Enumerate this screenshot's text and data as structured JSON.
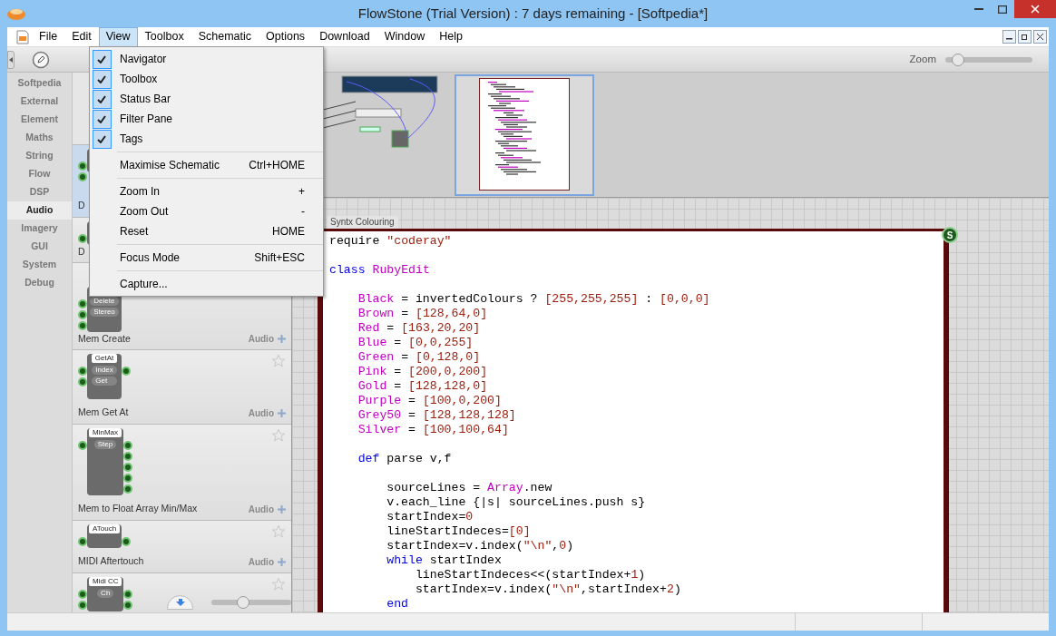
{
  "window": {
    "title": "FlowStone (Trial Version) : 7 days remaining - [Softpedia*]"
  },
  "menubar": [
    {
      "label": "File",
      "selected": false
    },
    {
      "label": "Edit",
      "selected": false
    },
    {
      "label": "View",
      "selected": true
    },
    {
      "label": "Toolbox",
      "selected": false
    },
    {
      "label": "Schematic",
      "selected": false
    },
    {
      "label": "Options",
      "selected": false
    },
    {
      "label": "Download",
      "selected": false
    },
    {
      "label": "Window",
      "selected": false
    },
    {
      "label": "Help",
      "selected": false
    }
  ],
  "view_menu": [
    {
      "kind": "check",
      "label": "Navigator",
      "checked": true
    },
    {
      "kind": "check",
      "label": "Toolbox",
      "checked": true
    },
    {
      "kind": "check",
      "label": "Status Bar",
      "checked": true
    },
    {
      "kind": "check",
      "label": "Filter Pane",
      "checked": true
    },
    {
      "kind": "check",
      "label": "Tags",
      "checked": true
    },
    {
      "kind": "separator"
    },
    {
      "kind": "item",
      "label": "Maximise Schematic",
      "shortcut": "Ctrl+HOME"
    },
    {
      "kind": "separator"
    },
    {
      "kind": "item",
      "label": "Zoom In",
      "shortcut": "+"
    },
    {
      "kind": "item",
      "label": "Zoom Out",
      "shortcut": "-"
    },
    {
      "kind": "item",
      "label": "Reset",
      "shortcut": "HOME"
    },
    {
      "kind": "separator"
    },
    {
      "kind": "item",
      "label": "Focus Mode",
      "shortcut": "Shift+ESC"
    },
    {
      "kind": "separator"
    },
    {
      "kind": "item",
      "label": "Capture..."
    }
  ],
  "categories": [
    {
      "label": "Softpedia",
      "selected": false
    },
    {
      "label": "External",
      "selected": false
    },
    {
      "label": "Element",
      "selected": false
    },
    {
      "label": "Maths",
      "selected": false
    },
    {
      "label": "String",
      "selected": false
    },
    {
      "label": "Flow",
      "selected": false
    },
    {
      "label": "DSP",
      "selected": false
    },
    {
      "label": "Audio",
      "selected": true
    },
    {
      "label": "Imagery",
      "selected": false
    },
    {
      "label": "GUI",
      "selected": false
    },
    {
      "label": "System",
      "selected": false
    },
    {
      "label": "Debug",
      "selected": false
    }
  ],
  "toolbox": {
    "components": [
      {
        "kind": "dual-pin",
        "title": "D",
        "selected": true
      },
      {
        "kind": "single-pin",
        "title": "D",
        "selected": false
      },
      {
        "kind": "mem-create",
        "title": "Mem Create",
        "tag": "Audio",
        "selected": false,
        "module": {
          "labels": [
            "Delete",
            "Stereo"
          ]
        }
      },
      {
        "kind": "get-at",
        "title": "Mem Get At",
        "tag": "Audio",
        "selected": false,
        "module": {
          "name": "GetAt",
          "labels": [
            "Index",
            "Get"
          ]
        }
      },
      {
        "kind": "min-max",
        "title": "Mem to Float Array Min/Max",
        "tag": "Audio",
        "selected": false,
        "module": {
          "name": "MinMax",
          "labels": [
            "Step"
          ]
        }
      },
      {
        "kind": "aftertouch",
        "title": "MIDI Aftertouch",
        "tag": "Audio",
        "selected": false,
        "module": {
          "name": "ATouch"
        }
      },
      {
        "kind": "midi-cc",
        "selected": false,
        "module": {
          "name": "Midi CC",
          "labels": [
            "Ch"
          ]
        }
      }
    ],
    "size_slider": {
      "level": 0.4
    }
  },
  "zoom": {
    "label": "Zoom",
    "level": 0.15
  },
  "module": {
    "tab": "Syntx Colouring",
    "badge": "S",
    "code": [
      {
        "tokens": [
          {
            "kind": "plain",
            "t": "require "
          },
          {
            "kind": "lit",
            "t": "\"coderay\""
          }
        ]
      },
      {
        "space_before": true,
        "tokens": [
          {
            "kind": "kw",
            "t": "class"
          },
          {
            "kind": "const",
            "t": " RubyEdit"
          }
        ],
        "children": [
          {
            "space_before": true,
            "tokens": [
              {
                "kind": "const",
                "t": "Black"
              },
              {
                "kind": "plain",
                "t": " = invertedColours ? "
              },
              {
                "kind": "lit",
                "t": "[255,255,255]"
              },
              {
                "kind": "plain",
                "t": " : "
              },
              {
                "kind": "lit",
                "t": "[0,0,0]"
              }
            ]
          },
          {
            "tokens": [
              {
                "kind": "const",
                "t": "Brown"
              },
              {
                "kind": "plain",
                "t": " = "
              },
              {
                "kind": "lit",
                "t": "[128,64,0]"
              }
            ]
          },
          {
            "tokens": [
              {
                "kind": "const",
                "t": "Red"
              },
              {
                "kind": "plain",
                "t": " = "
              },
              {
                "kind": "lit",
                "t": "[163,20,20]"
              }
            ]
          },
          {
            "tokens": [
              {
                "kind": "const",
                "t": "Blue"
              },
              {
                "kind": "plain",
                "t": " = "
              },
              {
                "kind": "lit",
                "t": "[0,0,255]"
              }
            ]
          },
          {
            "tokens": [
              {
                "kind": "const",
                "t": "Green"
              },
              {
                "kind": "plain",
                "t": " = "
              },
              {
                "kind": "lit",
                "t": "[0,128,0]"
              }
            ]
          },
          {
            "tokens": [
              {
                "kind": "const",
                "t": "Pink"
              },
              {
                "kind": "plain",
                "t": " = "
              },
              {
                "kind": "lit",
                "t": "[200,0,200]"
              }
            ]
          },
          {
            "tokens": [
              {
                "kind": "const",
                "t": "Gold"
              },
              {
                "kind": "plain",
                "t": " = "
              },
              {
                "kind": "lit",
                "t": "[128,128,0]"
              }
            ]
          },
          {
            "tokens": [
              {
                "kind": "const",
                "t": "Purple"
              },
              {
                "kind": "plain",
                "t": " = "
              },
              {
                "kind": "lit",
                "t": "[100,0,200]"
              }
            ]
          },
          {
            "tokens": [
              {
                "kind": "const",
                "t": "Grey50"
              },
              {
                "kind": "plain",
                "t": " = "
              },
              {
                "kind": "lit",
                "t": "[128,128,128]"
              }
            ]
          },
          {
            "tokens": [
              {
                "kind": "const",
                "t": "Silver"
              },
              {
                "kind": "plain",
                "t": " = "
              },
              {
                "kind": "lit",
                "t": "[100,100,64]"
              }
            ]
          },
          {
            "space_before": true,
            "tokens": [
              {
                "kind": "kw",
                "t": "def"
              },
              {
                "kind": "plain",
                "t": " parse v,f"
              }
            ],
            "children": [
              {
                "space_before": true,
                "tokens": [
                  {
                    "kind": "plain",
                    "t": "sourceLines = "
                  },
                  {
                    "kind": "const",
                    "t": "Array"
                  },
                  {
                    "kind": "plain",
                    "t": ".new"
                  }
                ]
              },
              {
                "tokens": [
                  {
                    "kind": "plain",
                    "t": "v.each_line {|s| sourceLines.push s}"
                  }
                ]
              },
              {
                "tokens": [
                  {
                    "kind": "plain",
                    "t": "startIndex="
                  },
                  {
                    "kind": "lit",
                    "t": "0"
                  }
                ]
              },
              {
                "tokens": [
                  {
                    "kind": "plain",
                    "t": "lineStartIndeces="
                  },
                  {
                    "kind": "lit",
                    "t": "[0]"
                  }
                ]
              },
              {
                "tokens": [
                  {
                    "kind": "plain",
                    "t": "startIndex=v.index("
                  },
                  {
                    "kind": "lit",
                    "t": "\"\\n\""
                  },
                  {
                    "kind": "plain",
                    "t": ","
                  },
                  {
                    "kind": "lit",
                    "t": "0"
                  },
                  {
                    "kind": "plain",
                    "t": ")"
                  }
                ]
              },
              {
                "tokens": [
                  {
                    "kind": "kw",
                    "t": "while"
                  },
                  {
                    "kind": "plain",
                    "t": " startIndex"
                  }
                ],
                "children": [
                  {
                    "tokens": [
                      {
                        "kind": "plain",
                        "t": "lineStartIndeces<<(startIndex+"
                      },
                      {
                        "kind": "lit",
                        "t": "1"
                      },
                      {
                        "kind": "plain",
                        "t": ")"
                      }
                    ]
                  },
                  {
                    "tokens": [
                      {
                        "kind": "plain",
                        "t": "startIndex=v.index("
                      },
                      {
                        "kind": "lit",
                        "t": "\"\\n\""
                      },
                      {
                        "kind": "plain",
                        "t": ",startIndex+"
                      },
                      {
                        "kind": "lit",
                        "t": "2"
                      },
                      {
                        "kind": "plain",
                        "t": ")"
                      }
                    ]
                  }
                ]
              },
              {
                "tokens": [
                  {
                    "kind": "kw",
                    "t": "end"
                  }
                ]
              }
            ]
          }
        ]
      }
    ]
  }
}
